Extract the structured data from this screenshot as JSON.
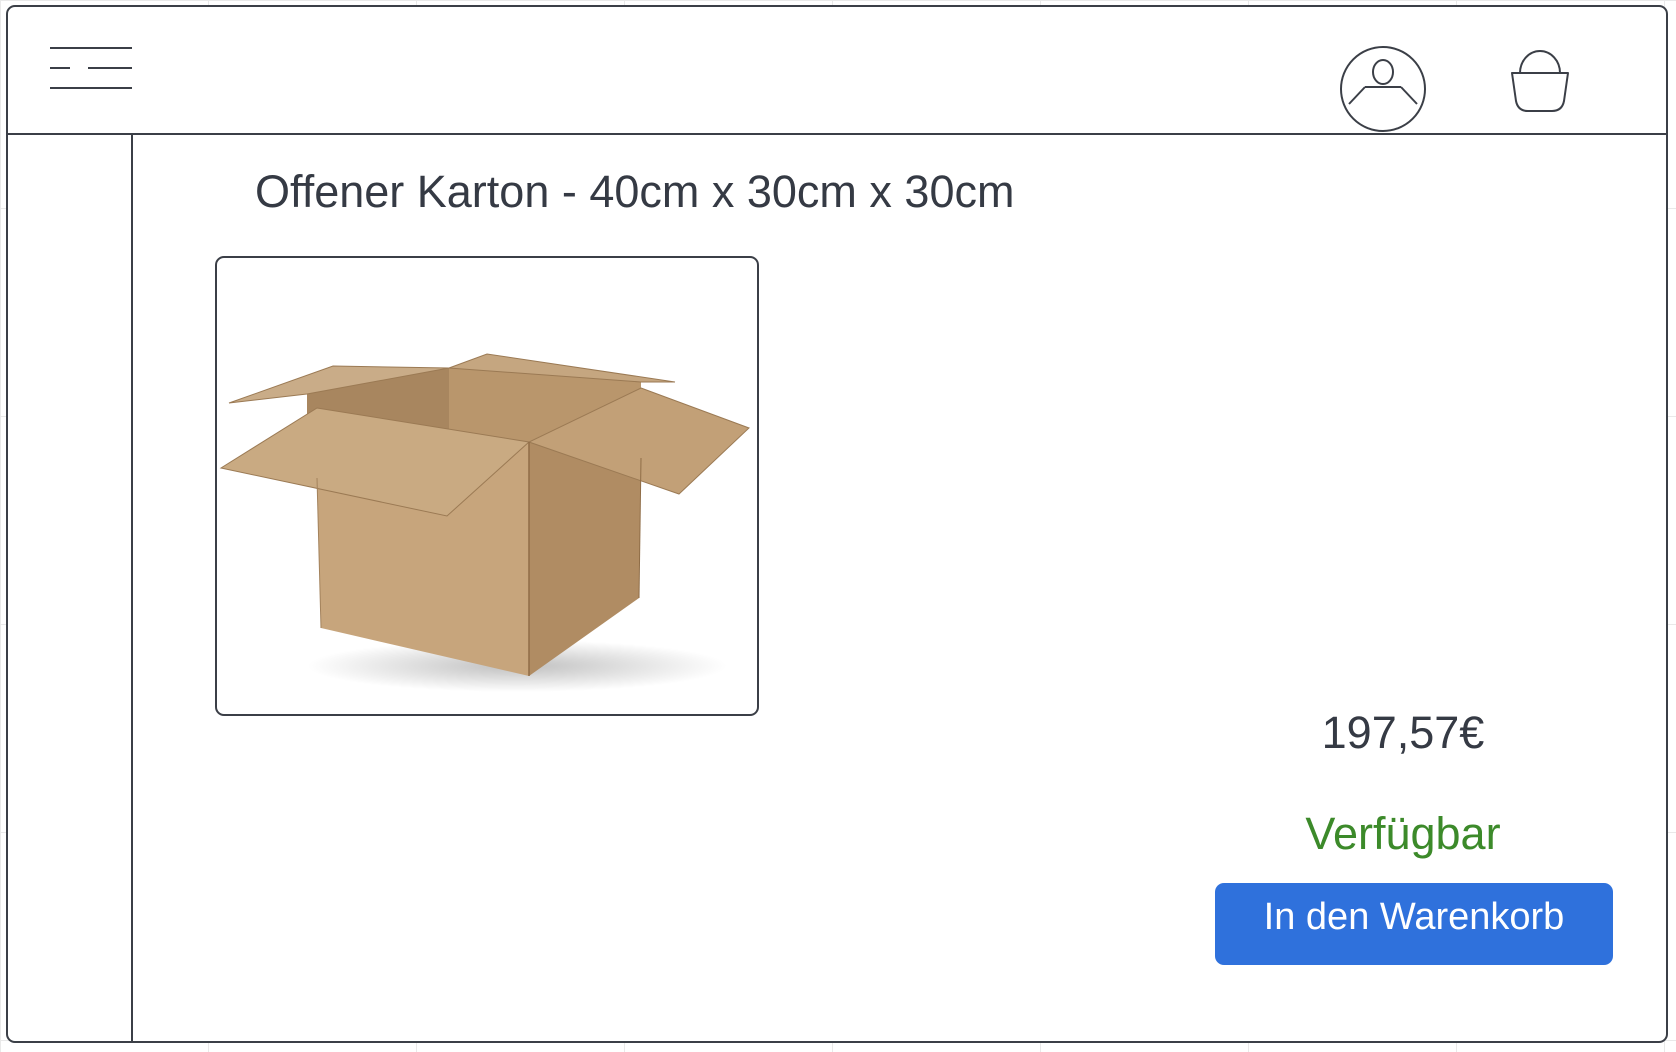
{
  "header": {
    "menu_icon": "hamburger-menu-icon",
    "account_icon": "user-account-icon",
    "cart_icon": "shopping-basket-icon"
  },
  "product": {
    "title": "Offener Karton - 40cm x 30cm x 30cm",
    "image_alt": "open-cardboard-box",
    "price": "197,57€",
    "availability": "Verfügbar",
    "add_to_cart_label": "In den Warenkorb"
  },
  "colors": {
    "outline": "#3b3f47",
    "text": "#353a44",
    "available_green": "#3c8a2a",
    "button_blue": "#2f71dc",
    "cardboard": "#c4a57f"
  }
}
